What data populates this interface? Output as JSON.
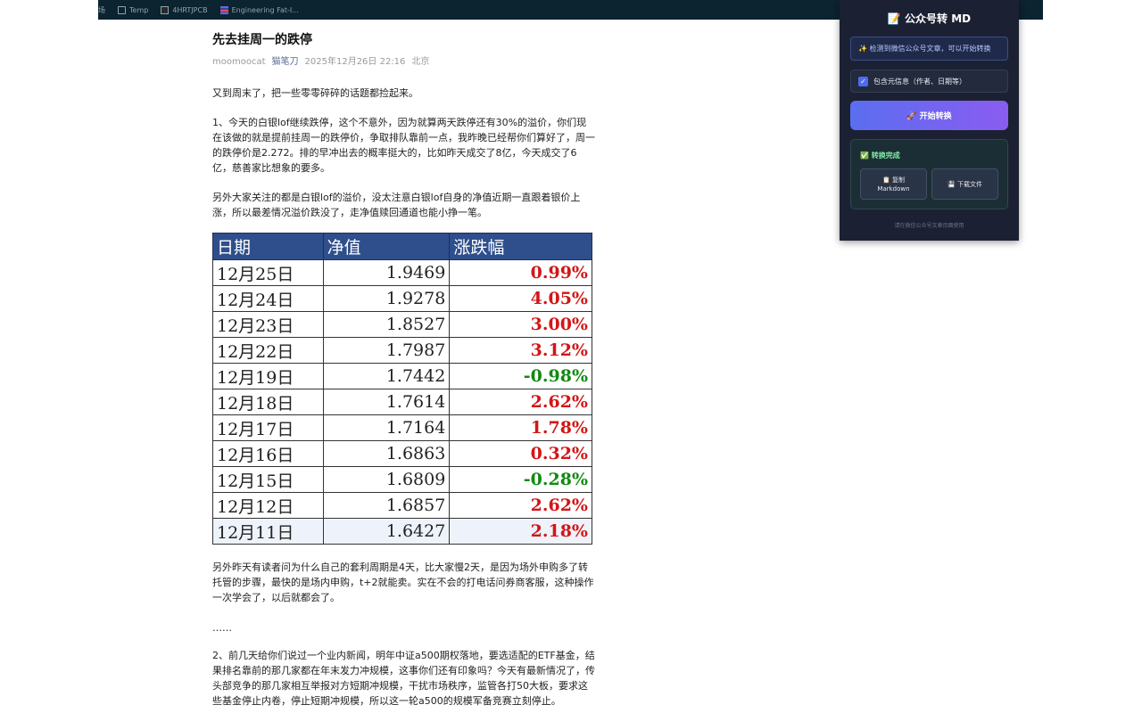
{
  "bookmarks": {
    "items": [
      {
        "label": "场",
        "icon": "folder-icon"
      },
      {
        "label": "Temp",
        "icon": "folder-icon"
      },
      {
        "label": "4HRTJPCB",
        "icon": "document-icon"
      },
      {
        "label": "Engineering Fat-I...",
        "icon": "stack-icon"
      }
    ]
  },
  "article": {
    "title": "先去挂周一的跌停",
    "meta": {
      "author": "moomoocat",
      "account": "猫笔刀",
      "datetime": "2025年12月26日 22:16",
      "location": "北京"
    },
    "paragraphs": [
      "又到周末了，把一些零零碎碎的话题都捡起来。",
      "1、今天的白银lof继续跌停，这个不意外，因为就算两天跌停还有30%的溢价，你们现在该做的就是提前挂周一的跌停价，争取排队靠前一点，我昨晚已经帮你们算好了，周一的跌停价是2.272。排的早冲出去的概率挺大的，比如昨天成交了8亿，今天成交了6亿，慈善家比想象的要多。",
      "另外大家关注的都是白银lof的溢价，没太注意白银lof自身的净值近期一直跟着银价上涨，所以最差情况溢价跌没了，走净值赎回通道也能小挣一笔。",
      "另外昨天有读者问为什么自己的套利周期是4天，比大家慢2天，是因为场外申购多了转托管的步骤，最快的是场内申购，t+2就能卖。实在不会的打电话问券商客服，这种操作一次学会了，以后就都会了。",
      "……",
      "2、前几天给你们说过一个业内新闻，明年中证a500期权落地，要选适配的ETF基金，结果排名靠前的那几家都在年末发力冲规模，这事你们还有印象吗？今天有最新情况了，传头部竞争的那几家相互举报对方短期冲规模，干扰市场秩序，监管各打50大板，要求这些基金停止内卷，停止短期冲规模，所以这一轮a500的规模军备竞赛立刻停止。"
    ],
    "table": {
      "headers": [
        "日期",
        "净值",
        "涨跌幅"
      ],
      "rows": [
        {
          "date": "12月25日",
          "nav": "1.9469",
          "change": "0.99%",
          "dir": "up"
        },
        {
          "date": "12月24日",
          "nav": "1.9278",
          "change": "4.05%",
          "dir": "up"
        },
        {
          "date": "12月23日",
          "nav": "1.8527",
          "change": "3.00%",
          "dir": "up"
        },
        {
          "date": "12月22日",
          "nav": "1.7987",
          "change": "3.12%",
          "dir": "up"
        },
        {
          "date": "12月19日",
          "nav": "1.7442",
          "change": "-0.98%",
          "dir": "down"
        },
        {
          "date": "12月18日",
          "nav": "1.7614",
          "change": "2.62%",
          "dir": "up"
        },
        {
          "date": "12月17日",
          "nav": "1.7164",
          "change": "1.78%",
          "dir": "up"
        },
        {
          "date": "12月16日",
          "nav": "1.6863",
          "change": "0.32%",
          "dir": "up"
        },
        {
          "date": "12月15日",
          "nav": "1.6809",
          "change": "-0.28%",
          "dir": "down"
        },
        {
          "date": "12月12日",
          "nav": "1.6857",
          "change": "2.62%",
          "dir": "up"
        },
        {
          "date": "12月11日",
          "nav": "1.6427",
          "change": "2.18%",
          "dir": "up"
        }
      ]
    }
  },
  "extension": {
    "title": "📝 公众号转 MD",
    "detected": "✨ 检测到微信公众号文章，可以开始转换",
    "include_meta_label": "包含元信息（作者、日期等）",
    "include_meta_checked": true,
    "convert_button": "🚀 开始转换",
    "done_title": "✅ 转换完成",
    "copy_button": "📋 复制 Markdown",
    "download_button": "💾 下载文件",
    "footer": "请在微信公众号文章页面使用"
  },
  "colors": {
    "table_header": "#2e4f8c",
    "up": "#d31616",
    "down": "#128a12",
    "panel_bg": "#1b2133",
    "button_gradient_start": "#5b6ef0",
    "button_gradient_end": "#8a5cf0"
  }
}
